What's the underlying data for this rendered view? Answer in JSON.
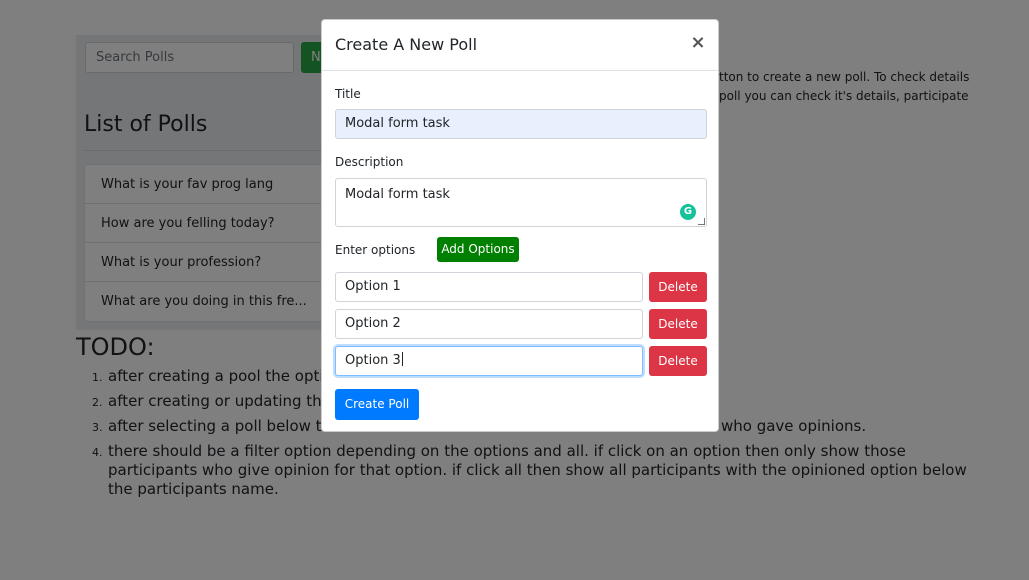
{
  "page": {
    "search_placeholder": "Search Polls",
    "new_button_label": "N",
    "polls_heading": "List of Polls",
    "polls": [
      "What is your fav prog lang",
      "How are you felling today?",
      "What is your profession?",
      "What are you doing in this fre..."
    ],
    "intro_lines": [
      "tton to create a new poll. To check details",
      "poll you can check it's details, participate"
    ],
    "todo_title": "TODO:",
    "todo_items": [
      {
        "num": "1.",
        "text": "after creating a pool the optio"
      },
      {
        "num": "2.",
        "text": "after creating or updating the"
      },
      {
        "num": "3.",
        "text": "after selecting a poll below th",
        "tail": "who gave opinions."
      },
      {
        "num": "4.",
        "text": "there should be a filter option depending on the options and all. if click on an option then only show those participants who give opinion for that option. if click all then show all participants with the opinioned option below the participants name."
      }
    ]
  },
  "modal": {
    "title": "Create A New Poll",
    "close_symbol": "×",
    "title_label": "Title",
    "title_value": "Modal form task",
    "description_label": "Description",
    "description_value": "Modal form task",
    "options_label": "Enter options",
    "add_options_label": "Add Options",
    "options": [
      {
        "value": "Option 1",
        "delete_label": "Delete"
      },
      {
        "value": "Option 2",
        "delete_label": "Delete"
      },
      {
        "value": "Option 3",
        "delete_label": "Delete"
      }
    ],
    "create_label": "Create Poll",
    "grammarly_badge": "G"
  },
  "colors": {
    "add_options": "#008000",
    "delete": "#dc3545",
    "primary": "#007bff",
    "new_button": "#28a745"
  }
}
